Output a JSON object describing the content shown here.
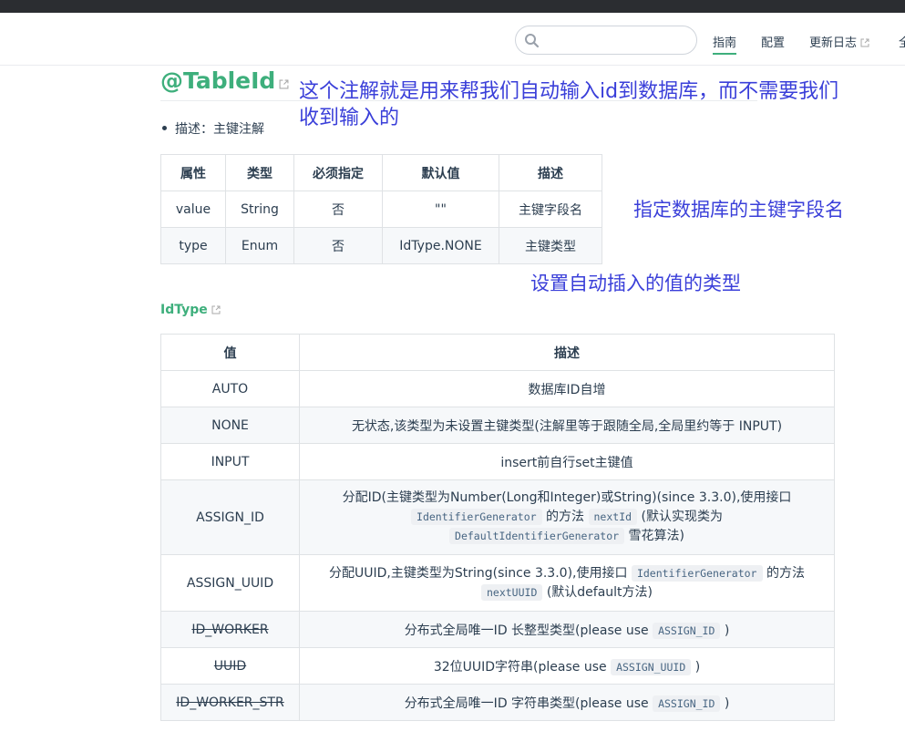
{
  "nav": {
    "search_placeholder": "",
    "items": [
      {
        "label": "指南",
        "active": true
      },
      {
        "label": "配置"
      },
      {
        "label": "更新日志",
        "external": true
      },
      {
        "label": "全"
      }
    ]
  },
  "heading": {
    "title": "@TableId"
  },
  "annotations": {
    "note1_line1": "这个注解就是用来帮我们自动输入id到数据库，而不需要我们",
    "note1_line2": "收到输入的",
    "note2": "指定数据库的主键字段名",
    "note3": "设置自动插入的值的类型"
  },
  "description": "描述：主键注解",
  "attr_table": {
    "headers": [
      "属性",
      "类型",
      "必须指定",
      "默认值",
      "描述"
    ],
    "rows": [
      [
        "value",
        "String",
        "否",
        "\"\"",
        "主键字段名"
      ],
      [
        "type",
        "Enum",
        "否",
        "IdType.NONE",
        "主键类型"
      ]
    ]
  },
  "idtype_link": "IdType",
  "idtype_table": {
    "headers": [
      "值",
      "描述"
    ],
    "rows": {
      "auto": {
        "value": "AUTO",
        "desc": "数据库ID自增"
      },
      "none": {
        "value": "NONE",
        "desc": "无状态,该类型为未设置主键类型(注解里等于跟随全局,全局里约等于 INPUT)"
      },
      "input": {
        "value": "INPUT",
        "desc": "insert前自行set主键值"
      },
      "assign_id": {
        "value": "ASSIGN_ID",
        "line1": "分配ID(主键类型为Number(Long和Integer)或String)(since 3.3.0),使用接口",
        "code1": "IdentifierGenerator",
        "text2": "的方法",
        "code2": "nextId",
        "text3": "(默认实现类为",
        "code3": "DefaultIdentifierGenerator",
        "text4": "雪花算法)"
      },
      "assign_uuid": {
        "value": "ASSIGN_UUID",
        "line1": "分配UUID,主键类型为String(since 3.3.0),使用接口",
        "code1": "IdentifierGenerator",
        "text2": "的方法",
        "code2": "nextUUID",
        "text3": "(默认default方法)"
      },
      "id_worker": {
        "value": "ID_WORKER",
        "text": "分布式全局唯一ID 长整型类型(please use",
        "code": "ASSIGN_ID",
        "end": ")"
      },
      "uuid": {
        "value": "UUID",
        "text": "32位UUID字符串(please use",
        "code": "ASSIGN_UUID",
        "end": ")"
      },
      "id_worker_str": {
        "value": "ID_WORKER_STR",
        "text": "分布式全局唯一ID 字符串类型(please use",
        "code": "ASSIGN_ID",
        "end": ")"
      }
    }
  }
}
